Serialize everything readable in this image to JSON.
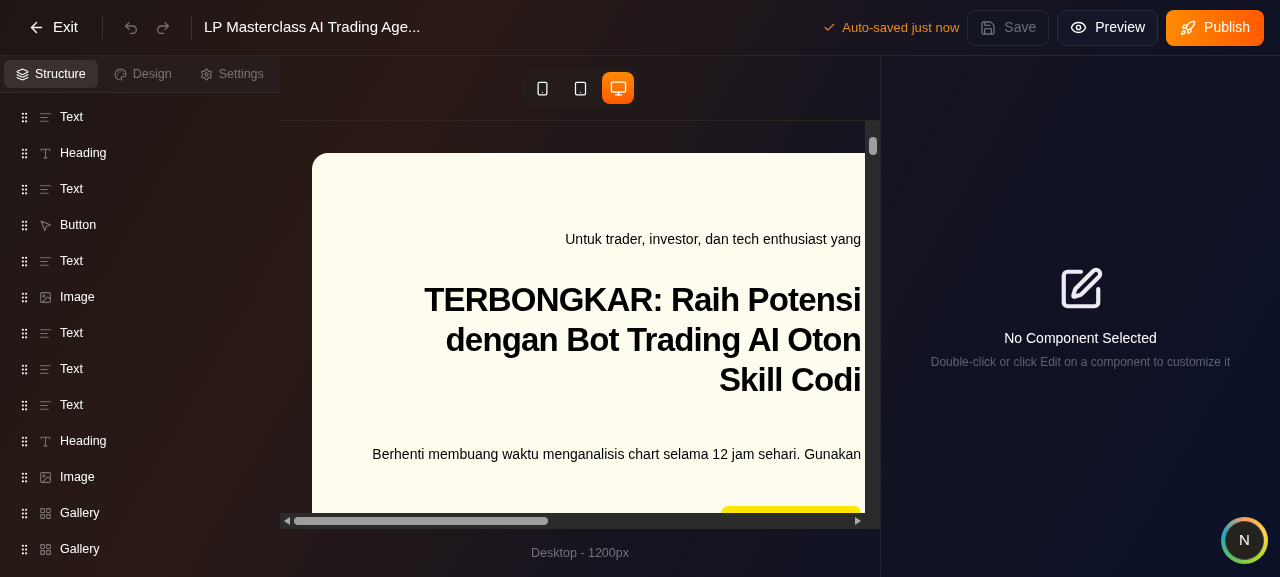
{
  "header": {
    "exit": "Exit",
    "title": "LP Masterclass AI Trading Age...",
    "autosave": "Auto-saved just now",
    "save": {
      "label": "Save",
      "disabled": true
    },
    "preview": "Preview",
    "publish": "Publish"
  },
  "panel_tabs": [
    {
      "label": "Structure",
      "kind": "structure",
      "selected": true
    },
    {
      "label": "Design",
      "kind": "design",
      "selected": false
    },
    {
      "label": "Settings",
      "kind": "settings",
      "selected": false
    }
  ],
  "structure": [
    {
      "label": "Text",
      "kind": "text"
    },
    {
      "label": "Heading",
      "kind": "heading"
    },
    {
      "label": "Text",
      "kind": "text"
    },
    {
      "label": "Button",
      "kind": "button"
    },
    {
      "label": "Text",
      "kind": "text"
    },
    {
      "label": "Image",
      "kind": "image"
    },
    {
      "label": "Text",
      "kind": "text"
    },
    {
      "label": "Text",
      "kind": "text"
    },
    {
      "label": "Text",
      "kind": "text"
    },
    {
      "label": "Heading",
      "kind": "heading"
    },
    {
      "label": "Image",
      "kind": "image"
    },
    {
      "label": "Gallery",
      "kind": "gallery"
    },
    {
      "label": "Gallery",
      "kind": "gallery"
    }
  ],
  "devices": [
    {
      "kind": "mobile",
      "selected": false
    },
    {
      "kind": "tablet",
      "selected": false
    },
    {
      "kind": "desktop",
      "selected": true
    }
  ],
  "preview_page": {
    "tagline": "Untuk trader, investor, dan tech enthusiast yang",
    "headline": [
      "TERBONGKAR: Raih Potensi",
      "dengan Bot Trading AI Oton",
      "Skill Codi"
    ],
    "body": "Berhenti membuang waktu menganalisis chart selama 12 jam sehari. Gunakan"
  },
  "canvas_label": "Desktop - 1200px",
  "inspector": {
    "title": "No Component Selected",
    "hint": "Double-click or click Edit on a component to customize it"
  },
  "avatar": {
    "initial": "N"
  }
}
